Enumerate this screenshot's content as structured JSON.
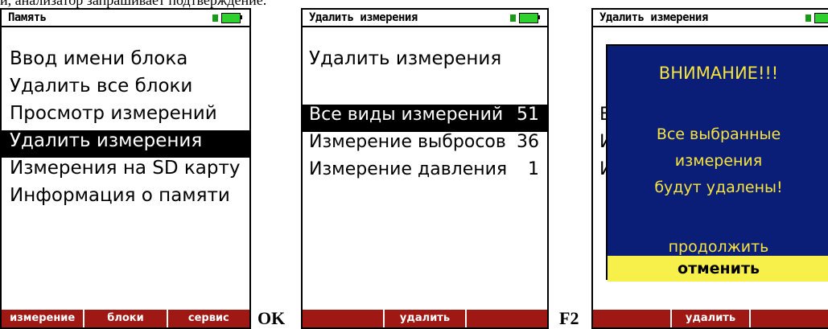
{
  "caption": "и, анализатор запрашивает подтверждение.",
  "battery_color": "#2ed12e",
  "softkey_color": "#a01814",
  "dialog_color": "#0a1e78",
  "screen1": {
    "title": "Память",
    "menu": [
      "Ввод имени блока",
      "Удалить все блоки",
      "Просмотр измерений",
      "Удалить измерения",
      "Измерения на SD карту",
      "Информация о памяти"
    ],
    "selected": "Удалить измерения",
    "softkeys": [
      "измерение",
      "блоки",
      "сервис"
    ]
  },
  "key1": "OK",
  "screen2": {
    "title": "Удалить измерения",
    "heading": "Удалить измерения",
    "items": [
      {
        "label": "Все виды измерений",
        "count": "51"
      },
      {
        "label": "Измерение выбросов",
        "count": "36"
      },
      {
        "label": "Измерение давления",
        "count": "1"
      }
    ],
    "softkeys": [
      "",
      "удалить",
      ""
    ]
  },
  "key2": "F2",
  "screen3": {
    "title": "Удалить измерения",
    "dialog": {
      "title": "ВНИМАНИЕ!!!",
      "message_lines": [
        "Все выбранные",
        "измерения",
        "будут удалены!"
      ],
      "options": [
        "продолжить",
        "отменить"
      ]
    },
    "softkeys": [
      "",
      "удалить",
      ""
    ]
  }
}
